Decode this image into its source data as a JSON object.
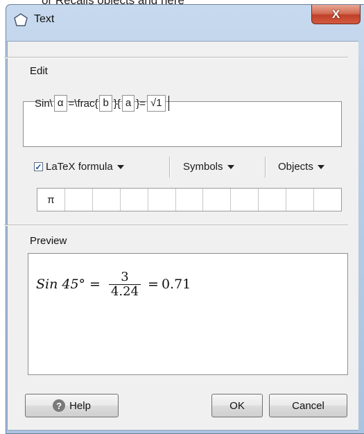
{
  "top_cut_text": "or Recalls objects and here",
  "window": {
    "title": "Text",
    "close_label": "X"
  },
  "edit": {
    "label": "Edit",
    "segments": [
      "Sin\\",
      "α",
      "=\\frac{",
      "b",
      "}{",
      "a",
      "}=",
      "√1"
    ]
  },
  "toolbar": {
    "latex_label": "LaTeX formula",
    "latex_checked": true,
    "symbols_label": "Symbols",
    "objects_label": "Objects"
  },
  "symbols": [
    "π",
    "",
    "",
    "",
    "",
    "",
    "",
    "",
    "",
    "",
    ""
  ],
  "preview": {
    "label": "Preview",
    "lhs": "Sin 45°",
    "eq1": "=",
    "numerator": "3",
    "denominator": "4.24",
    "eq2": "=",
    "result": "0.71"
  },
  "buttons": {
    "help": "Help",
    "help_glyph": "?",
    "ok": "OK",
    "cancel": "Cancel"
  }
}
